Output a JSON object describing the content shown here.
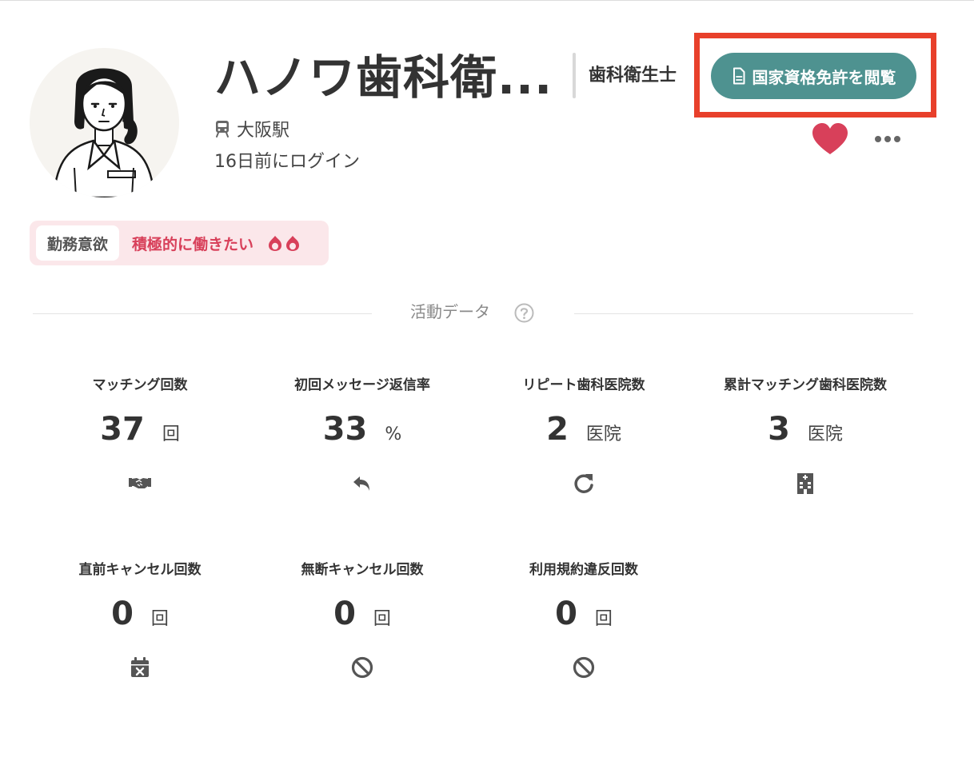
{
  "profile": {
    "name": "ハノワ歯科衛...",
    "station": "大阪駅",
    "last_login": "16日前にログイン",
    "occupation": "歯科衛生士",
    "license_button": "国家資格免許を閲覧"
  },
  "motivation": {
    "label": "勤務意欲",
    "value": "積極的に働きたい"
  },
  "activity": {
    "title": "活動データ",
    "stats": [
      {
        "label": "マッチング回数",
        "value": "37",
        "unit": "回",
        "icon": "handshake-icon"
      },
      {
        "label": "初回メッセージ返信率",
        "value": "33",
        "unit": "%",
        "icon": "reply-icon"
      },
      {
        "label": "リピート歯科医院数",
        "value": "2",
        "unit": "医院",
        "icon": "repeat-icon"
      },
      {
        "label": "累計マッチング歯科医院数",
        "value": "3",
        "unit": "医院",
        "icon": "hospital-building-icon"
      },
      {
        "label": "直前キャンセル回数",
        "value": "0",
        "unit": "回",
        "icon": "calendar-cancel-icon"
      },
      {
        "label": "無断キャンセル回数",
        "value": "0",
        "unit": "回",
        "icon": "ban-icon"
      },
      {
        "label": "利用規約違反回数",
        "value": "0",
        "unit": "回",
        "icon": "ban-icon"
      }
    ]
  },
  "colors": {
    "accent": "#4e9290",
    "highlight_border": "#e8402b",
    "heart": "#d8405a",
    "motivation_bg": "#fbe7ea"
  }
}
